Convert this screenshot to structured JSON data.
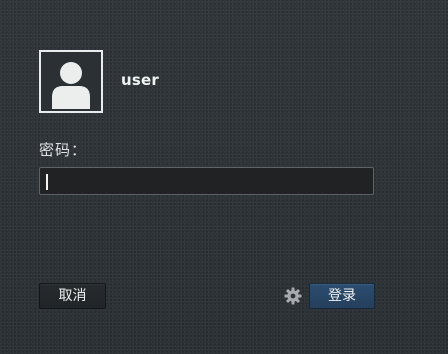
{
  "user": {
    "name": "user",
    "avatar_icon": "user-silhouette-icon"
  },
  "password": {
    "label": "密码：",
    "value": ""
  },
  "buttons": {
    "cancel_label": "取消",
    "login_label": "登录",
    "settings_icon": "gear-icon"
  },
  "colors": {
    "background": "#2d3336",
    "login_button": "#2c4d70",
    "field_background": "#202224"
  }
}
